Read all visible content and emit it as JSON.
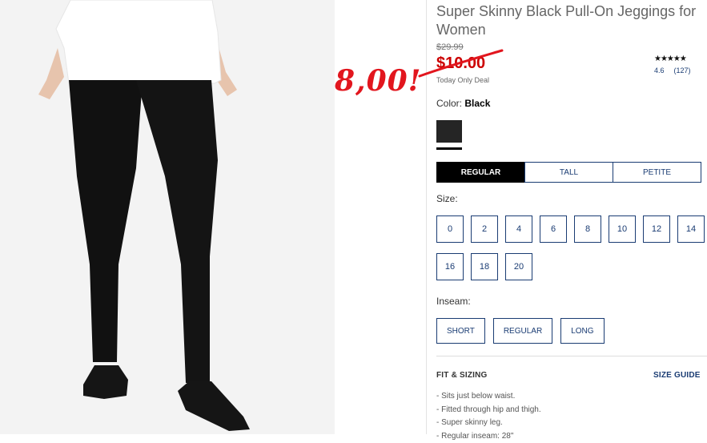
{
  "product": {
    "title": "Super Skinny Black Pull-On Jeggings for Women",
    "original_price": "$29.99",
    "sale_price": "$10.00",
    "deal_label": "Today Only Deal",
    "handwritten_price": "8,00!",
    "rating_stars": "★★★★★",
    "rating_value": "4.6",
    "review_count": "(127)"
  },
  "color": {
    "label": "Color:",
    "value": "Black",
    "swatch_hex": "#252525"
  },
  "fit_tabs": [
    {
      "label": "REGULAR",
      "active": true
    },
    {
      "label": "TALL",
      "active": false
    },
    {
      "label": "PETITE",
      "active": false
    }
  ],
  "size": {
    "label": "Size:",
    "options": [
      "0",
      "2",
      "4",
      "6",
      "8",
      "10",
      "12",
      "14",
      "16",
      "18",
      "20"
    ]
  },
  "inseam": {
    "label": "Inseam:",
    "options": [
      "SHORT",
      "REGULAR",
      "LONG"
    ]
  },
  "details": {
    "heading": "FIT & SIZING",
    "size_guide_label": "SIZE GUIDE",
    "bullets": [
      "Sits just below waist.",
      "Fitted through hip and thigh.",
      "Super skinny leg.",
      "Regular inseam: 28\""
    ]
  },
  "colors": {
    "sale_red": "#cc0000",
    "annotation_red": "#e2161e",
    "link_navy": "#1a3c73"
  }
}
